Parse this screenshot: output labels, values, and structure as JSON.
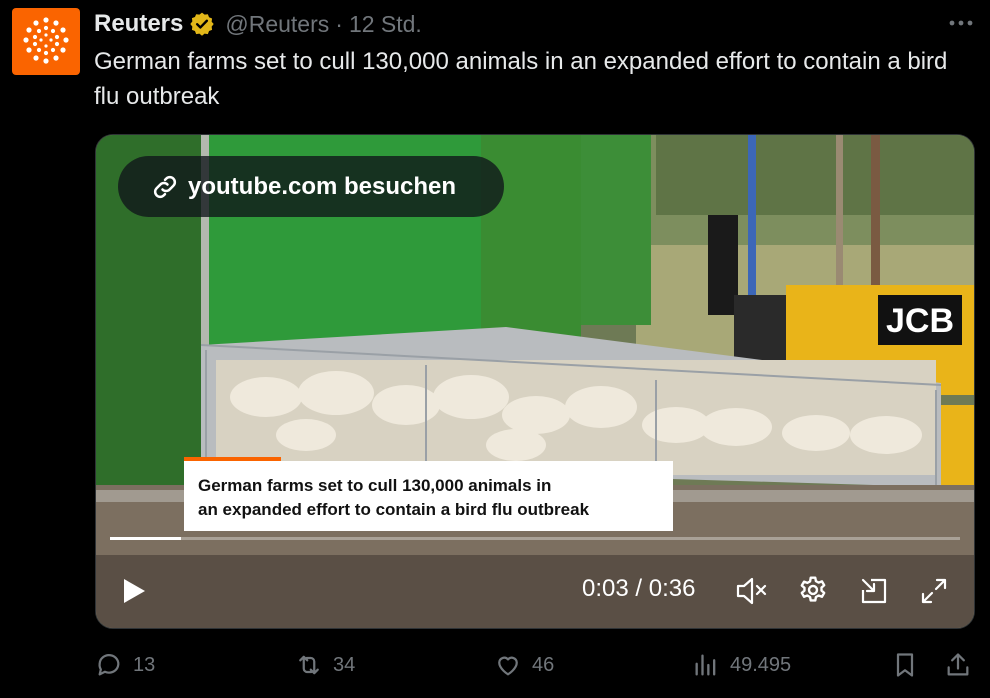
{
  "author": {
    "name": "Reuters",
    "handle": "@Reuters",
    "separator": "·",
    "time": "12 Std.",
    "brand_color": "#fa6400",
    "verified_color": "#e2b719"
  },
  "tweet": {
    "text": "German farms set to cull 130,000 animals in an expanded effort to contain a bird flu outbreak"
  },
  "video": {
    "visit_label": "youtube.com besuchen",
    "caption_line1": "German farms set to cull 130,000 animals in",
    "caption_line2": "an expanded effort to contain a bird flu outbreak",
    "current_time": "0:03",
    "duration": "0:36",
    "time_separator": "/",
    "progress_fraction": 0.083,
    "truck_brand": "JCB",
    "icons": [
      "link-icon",
      "play-icon",
      "mute-icon",
      "settings-icon",
      "dock-icon",
      "fullscreen-icon"
    ]
  },
  "actions": {
    "replies": "13",
    "reposts": "34",
    "likes": "46",
    "views": "49.495",
    "icons": [
      "reply-icon",
      "repost-icon",
      "like-icon",
      "views-icon",
      "bookmark-icon",
      "share-icon"
    ]
  }
}
